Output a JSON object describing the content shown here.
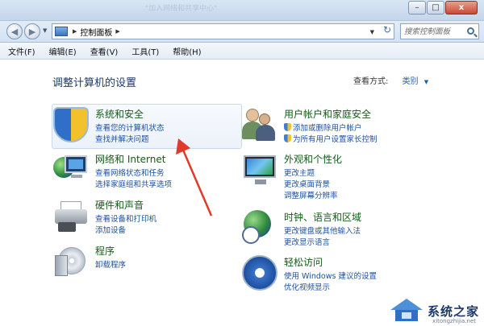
{
  "window": {
    "title_faint": "\"加入网络和共享中心\"",
    "minimize": "–",
    "maximize": "□",
    "close": "x"
  },
  "address_bar": {
    "back": "◀",
    "forward": "▶",
    "crumb": "控制面板",
    "refresh": "↻",
    "search_placeholder": "搜索控制面板"
  },
  "menu": [
    "文件(F)",
    "编辑(E)",
    "查看(V)",
    "工具(T)",
    "帮助(H)"
  ],
  "heading": "调整计算机的设置",
  "view_by": {
    "label": "查看方式:",
    "value": "类别"
  },
  "categories": {
    "system": {
      "title": "系统和安全",
      "icon": "shield-icon",
      "links": [
        "查看您的计算机状态",
        "查找并解决问题"
      ]
    },
    "network": {
      "title": "网络和 Internet",
      "icon": "network-icon",
      "links": [
        "查看网络状态和任务",
        "选择家庭组和共享选项"
      ]
    },
    "hardware": {
      "title": "硬件和声音",
      "icon": "printer-icon",
      "links": [
        "查看设备和打印机",
        "添加设备"
      ]
    },
    "programs": {
      "title": "程序",
      "icon": "programs-icon",
      "links": [
        "卸载程序"
      ]
    },
    "users": {
      "title": "用户帐户和家庭安全",
      "icon": "users-icon",
      "links": [
        "添加或删除用户帐户",
        "为所有用户设置家长控制"
      ]
    },
    "appearance": {
      "title": "外观和个性化",
      "icon": "monitor-icon",
      "links": [
        "更改主题",
        "更改桌面背景",
        "调整屏幕分辨率"
      ]
    },
    "clock": {
      "title": "时钟、语言和区域",
      "icon": "clock-globe-icon",
      "links": [
        "更改键盘或其他输入法",
        "更改显示语言"
      ]
    },
    "ease": {
      "title": "轻松访问",
      "icon": "ease-of-access-icon",
      "links": [
        "使用 Windows 建议的设置",
        "优化视频显示"
      ]
    }
  },
  "watermark": {
    "text": "系统之家",
    "url": "xitongzhijia.net"
  },
  "colors": {
    "title_green": "#155a18",
    "link_blue": "#1e50a0",
    "heading_blue": "#1c3a69",
    "arrow_red": "#e03a2a"
  }
}
